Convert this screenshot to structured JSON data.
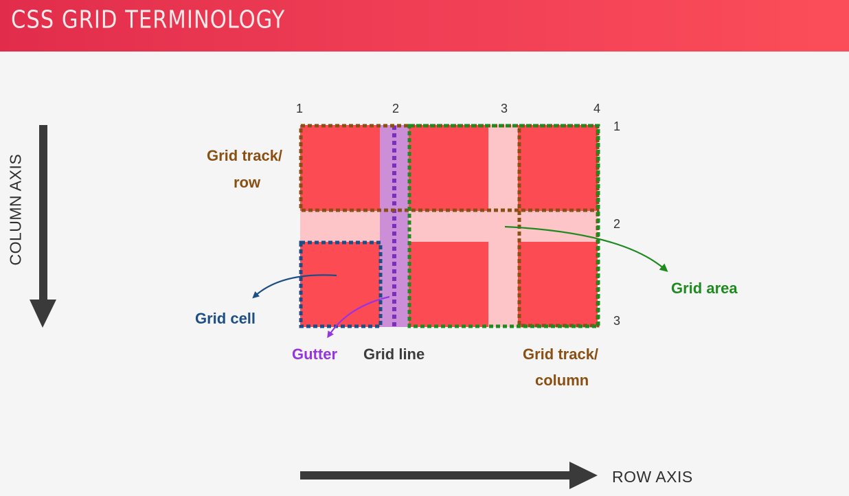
{
  "title": "CSS GRID TERMINOLOGY",
  "column_line_numbers": [
    "1",
    "2",
    "3",
    "4"
  ],
  "row_line_numbers": [
    "1",
    "2",
    "3"
  ],
  "labels": {
    "track_row_line1": "Grid track/",
    "track_row_line2": "row",
    "grid_cell": "Grid cell",
    "gutter": "Gutter",
    "grid_line": "Grid line",
    "track_column_line1": "Grid track/",
    "track_column_line2": "column",
    "grid_area": "Grid area"
  },
  "axes": {
    "column_axis": "COLUMN AXIS",
    "row_axis": "ROW AXIS"
  },
  "colors": {
    "header_start": "#e12d4b",
    "header_end": "#fb4d59",
    "cell": "#fd4b54",
    "gutter": "#fdc5c7",
    "gutter_highlight": "#cd8ed8",
    "track_outline": "#8a4f12",
    "cell_outline": "#1d4e86",
    "area_outline": "#1f8a1f",
    "line_outline": "#7a2fbf",
    "axis_arrow": "#3a3a3a"
  }
}
